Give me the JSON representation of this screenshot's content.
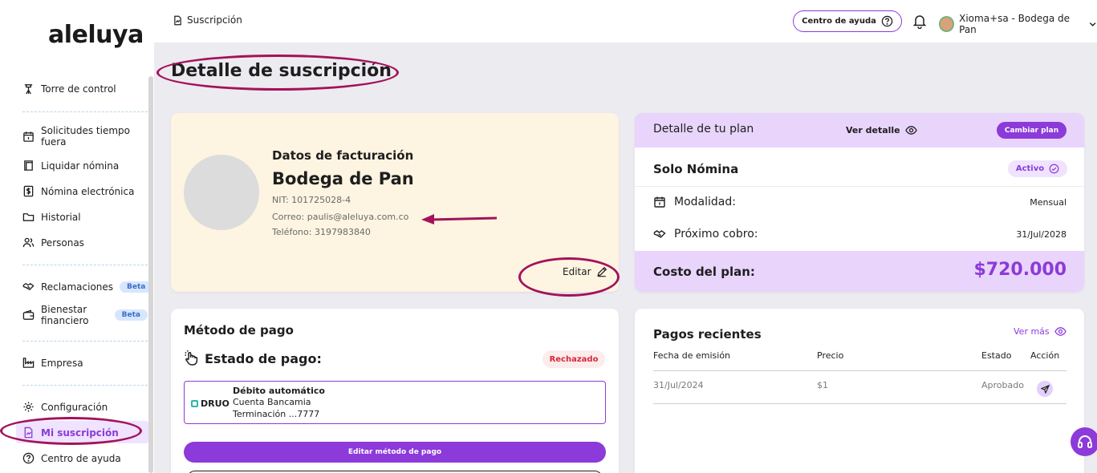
{
  "sidebar": {
    "logo": "aleluya",
    "items": [
      {
        "label": "Torre de control"
      },
      {
        "label": "Solicitudes tiempo fuera"
      },
      {
        "label": "Liquidar nómina"
      },
      {
        "label": "Nómina electrónica"
      },
      {
        "label": "Historial"
      },
      {
        "label": "Personas"
      },
      {
        "label": "Reclamaciones",
        "badge": "Beta"
      },
      {
        "label": "Bienestar financiero",
        "badge": "Beta"
      },
      {
        "label": "Empresa"
      },
      {
        "label": "Configuración"
      },
      {
        "label": "Mi suscripción"
      },
      {
        "label": "Centro de ayuda"
      }
    ]
  },
  "topbar": {
    "breadcrumb": "Suscripción",
    "help_label": "Centro de ayuda",
    "user_name": "Xioma+sa - Bodega de Pan"
  },
  "page": {
    "title": "Detalle de suscripción"
  },
  "billing": {
    "heading": "Datos de facturación",
    "company": "Bodega de Pan",
    "nit": "NIT: 101725028-4",
    "email": "Correo: paulis@aleluya.com.co",
    "phone": "Teléfono: 3197983840",
    "edit_label": "Editar"
  },
  "plan": {
    "heading": "Detalle de tu plan",
    "view_detail": "Ver detalle",
    "change_plan": "Cambiar plan",
    "name": "Solo Nómina",
    "status": "Activo",
    "modality_label": "Modalidad:",
    "modality_value": "Mensual",
    "next_charge_label": "Próximo cobro:",
    "next_charge_value": "31/Jul/2028",
    "cost_label": "Costo del plan:",
    "cost_value": "$720.000"
  },
  "payment": {
    "heading": "Método de pago",
    "state_label": "Estado de pago:",
    "state_value": "Rechazado",
    "provider": "DRUO",
    "method_title": "Débito automático",
    "method_bank": "Cuenta Bancamia",
    "method_ending": "Terminación ...7777",
    "edit_button": "Editar método de pago"
  },
  "recent_payments": {
    "heading": "Pagos recientes",
    "see_more": "Ver más",
    "columns": [
      "Fecha de emisión",
      "Precio",
      "Estado",
      "Acción"
    ],
    "rows": [
      {
        "date": "31/Jul/2024",
        "price": "$1",
        "status": "Aprobado"
      }
    ]
  },
  "colors": {
    "accent": "#8c3ad9",
    "annotation": "#a3125a",
    "plan_header": "#e9d4fb",
    "billing_bg": "#fdf4e1",
    "rejected": "#d6283a"
  }
}
